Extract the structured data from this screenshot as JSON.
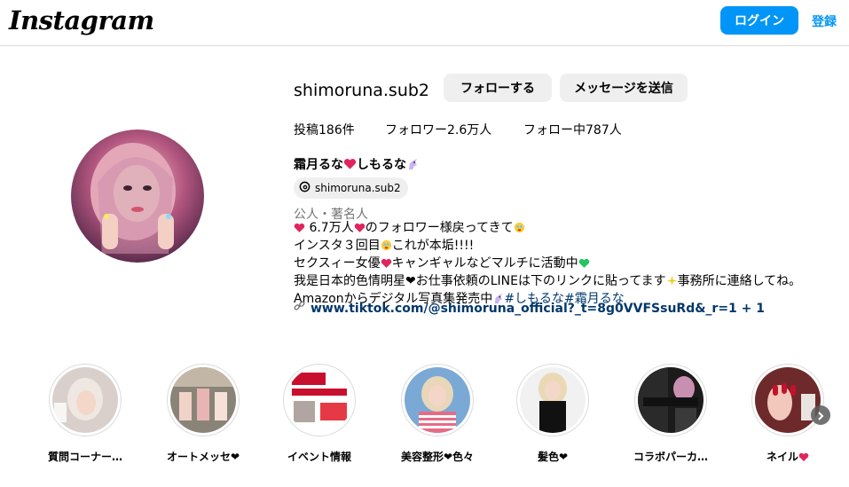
{
  "header": {
    "logo_text": "Instagram",
    "login_label": "ログイン",
    "signup_label": "登録"
  },
  "profile": {
    "username": "shimoruna.sub2",
    "follow_label": "フォローする",
    "message_label": "メッセージを送信",
    "posts": "投稿186件",
    "followers": "フォロワー2.6万人",
    "following": "フォロー中787人",
    "full_name_a": "霜月るな",
    "full_name_b": "しもるな",
    "threads_handle": "shimoruna.sub2",
    "category": "公人・著名人",
    "bio": {
      "l1a": "6.7万人",
      "l1b": "のフォロワー様戻ってきて",
      "l2a": "インスタ３回目",
      "l2b": "これが本垢!!!!",
      "l3a": "セクスィー女優",
      "l3b": "キャンギャルなどマルチに活動中",
      "l4a": "我是日本的色情明星❤︎お仕事依頼のLINEは下のリンクに貼ってます",
      "l4b": "事務所に連絡してね。",
      "l5a": "Amazonからデジタル写真集発売中",
      "l5_tag1": "#しもるな",
      "l5_tag2": "#霜月るな"
    },
    "link": "www.tiktok.com/@shimoruna_official?_t=8g0VVFSsuRd&_r=1 + 1"
  },
  "highlights": [
    {
      "label": "質問コーナー…"
    },
    {
      "label": "オートメッセ❤︎"
    },
    {
      "label": "イベント情報"
    },
    {
      "label": "美容整形❤︎色々"
    },
    {
      "label": "髪色❤︎"
    },
    {
      "label": "コラボパーカ…"
    },
    {
      "label": "ネイル"
    }
  ],
  "colors": {
    "accent": "#0095f6",
    "heart": "#e0245e",
    "link": "#00376b"
  }
}
